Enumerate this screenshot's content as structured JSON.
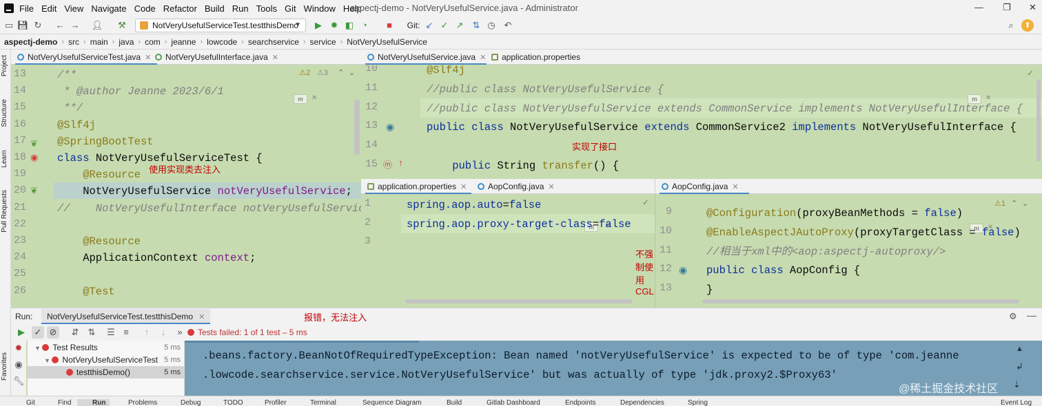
{
  "menubar": {
    "items": [
      "File",
      "Edit",
      "View",
      "Navigate",
      "Code",
      "Refactor",
      "Build",
      "Run",
      "Tools",
      "Git",
      "Window",
      "Help"
    ],
    "title": "aspectj-demo - NotVeryUsefulService.java - Administrator"
  },
  "toolbar": {
    "run_config": "NotVeryUsefulServiceTest.testthisDemo",
    "git_label": "Git:"
  },
  "breadcrumb": [
    "aspectj-demo",
    "src",
    "main",
    "java",
    "com",
    "jeanne",
    "lowcode",
    "searchservice",
    "service",
    "NotVeryUsefulService"
  ],
  "left_strip": [
    "Project",
    "Structure",
    "Learn",
    "Pull Requests",
    "Favorites"
  ],
  "left_editor": {
    "tabs": [
      "NotVeryUsefulServiceTest.java",
      "NotVeryUsefulInterface.java"
    ],
    "inspections": {
      "warnings": "2",
      "weak": "3"
    },
    "lines": [
      {
        "n": "13",
        "parts": [
          {
            "c": "cm",
            "t": "/**"
          }
        ]
      },
      {
        "n": "14",
        "parts": [
          {
            "c": "cm",
            "t": " * @author Jeanne 2023/6/1"
          }
        ]
      },
      {
        "n": "15",
        "parts": [
          {
            "c": "cm",
            "t": " **/"
          }
        ]
      },
      {
        "n": "16",
        "parts": [
          {
            "c": "an",
            "t": "@Slf4j"
          }
        ]
      },
      {
        "n": "17",
        "parts": [
          {
            "c": "an",
            "t": "@SpringBootTest"
          }
        ]
      },
      {
        "n": "18",
        "parts": [
          {
            "c": "kw",
            "t": "class "
          },
          {
            "c": "",
            "t": "NotVeryUsefulServiceTest {"
          }
        ]
      },
      {
        "n": "19",
        "parts": [
          {
            "c": "an",
            "t": "    @Resource"
          }
        ]
      },
      {
        "n": "20",
        "parts": [
          {
            "c": "",
            "t": "    NotVeryUsefulService "
          },
          {
            "c": "fld",
            "t": "notVeryUsefulService"
          },
          {
            "c": "",
            "t": ";"
          }
        ]
      },
      {
        "n": "21",
        "parts": [
          {
            "c": "cm",
            "t": "//    NotVeryUsefulInterface notVeryUsefulService;"
          }
        ]
      },
      {
        "n": "22",
        "parts": [
          {
            "c": "",
            "t": ""
          }
        ]
      },
      {
        "n": "23",
        "parts": [
          {
            "c": "an",
            "t": "    @Resource"
          }
        ]
      },
      {
        "n": "24",
        "parts": [
          {
            "c": "",
            "t": "    ApplicationContext "
          },
          {
            "c": "fld",
            "t": "context"
          },
          {
            "c": "",
            "t": ";"
          }
        ]
      },
      {
        "n": "25",
        "parts": [
          {
            "c": "",
            "t": ""
          }
        ]
      },
      {
        "n": "26",
        "parts": [
          {
            "c": "an",
            "t": "    @Test"
          }
        ]
      }
    ],
    "annotation": "使用实现类去注入"
  },
  "right_top_editor": {
    "tabs": [
      "NotVeryUsefulService.java",
      "application.properties"
    ],
    "lines": [
      {
        "n": "10",
        "parts": [
          {
            "c": "an",
            "t": "@Slf4j"
          }
        ]
      },
      {
        "n": "11",
        "parts": [
          {
            "c": "cm",
            "t": "//public class NotVeryUsefulService {"
          }
        ]
      },
      {
        "n": "12",
        "parts": [
          {
            "c": "cm",
            "t": "//public class NotVeryUsefulService extends CommonService implements NotVeryUsefulInterface {"
          }
        ]
      },
      {
        "n": "13",
        "parts": [
          {
            "c": "kw",
            "t": "public class "
          },
          {
            "c": "",
            "t": "NotVeryUsefulService "
          },
          {
            "c": "kw",
            "t": "extends "
          },
          {
            "c": "",
            "t": "CommonService2 "
          },
          {
            "c": "kw",
            "t": "implements "
          },
          {
            "c": "",
            "t": "NotVeryUsefulInterface {"
          }
        ]
      },
      {
        "n": "14",
        "parts": [
          {
            "c": "",
            "t": ""
          }
        ]
      },
      {
        "n": "15",
        "parts": [
          {
            "c": "kw",
            "t": "    public "
          },
          {
            "c": "",
            "t": "String "
          },
          {
            "c": "an",
            "t": "transfer"
          },
          {
            "c": "",
            "t": "() {"
          }
        ]
      }
    ],
    "annotation": "实现了接口"
  },
  "props_editor": {
    "tabs": [
      "application.properties",
      "AopConfig.java"
    ],
    "lines": [
      {
        "n": "1",
        "parts": [
          {
            "c": "kw",
            "t": "spring.aop.auto"
          },
          {
            "c": "",
            "t": "="
          },
          {
            "c": "kw",
            "t": "false"
          }
        ]
      },
      {
        "n": "2",
        "parts": [
          {
            "c": "kw",
            "t": "spring.aop.proxy-target-class"
          },
          {
            "c": "",
            "t": "="
          },
          {
            "c": "kw",
            "t": "false"
          }
        ]
      },
      {
        "n": "3",
        "parts": [
          {
            "c": "",
            "t": ""
          }
        ]
      }
    ],
    "annotation": "不强制使用CGLIb"
  },
  "aop_editor": {
    "tabs": [
      "AopConfig.java"
    ],
    "inspections": {
      "warnings": "1"
    },
    "lines": [
      {
        "n": "9",
        "parts": [
          {
            "c": "an",
            "t": "@Configuration"
          },
          {
            "c": "",
            "t": "(proxyBeanMethods = "
          },
          {
            "c": "kw",
            "t": "false"
          },
          {
            "c": "",
            "t": ")"
          }
        ]
      },
      {
        "n": "10",
        "parts": [
          {
            "c": "an",
            "t": "@EnableAspectJAutoProxy"
          },
          {
            "c": "",
            "t": "(proxyTargetClass = "
          },
          {
            "c": "kw",
            "t": "false"
          },
          {
            "c": "",
            "t": ")"
          }
        ]
      },
      {
        "n": "11",
        "parts": [
          {
            "c": "cm",
            "t": "//相当于xml中的<aop:aspectj-autoproxy/>"
          }
        ]
      },
      {
        "n": "12",
        "parts": [
          {
            "c": "kw",
            "t": "public class "
          },
          {
            "c": "",
            "t": "AopConfig {"
          }
        ]
      },
      {
        "n": "13",
        "parts": [
          {
            "c": "",
            "t": "}"
          }
        ]
      }
    ]
  },
  "run_panel": {
    "label": "Run:",
    "tab": "NotVeryUsefulServiceTest.testthisDemo",
    "annotation": "报错，无法注入",
    "status": "Tests failed: 1 of 1 test – 5 ms",
    "tree": [
      {
        "label": "Test Results",
        "ms": "5 ms",
        "indent": 0
      },
      {
        "label": "NotVeryUsefulServiceTest",
        "ms": "5 ms",
        "indent": 1
      },
      {
        "label": "testthisDemo()",
        "ms": "5 ms",
        "indent": 2
      }
    ],
    "console": [
      ".beans.factory.BeanNotOfRequiredTypeException: Bean named 'notVeryUsefulService' is expected to be of type 'com.jeanne",
      ".lowcode.searchservice.service.NotVeryUsefulService' but was actually of type 'jdk.proxy2.$Proxy63'"
    ]
  },
  "statusbar": [
    "Git",
    "Find",
    "Run",
    "Problems",
    "Debug",
    "TODO",
    "Profiler",
    "Terminal",
    "Sequence Diagram",
    "Build",
    "Gitlab Dashboard",
    "Endpoints",
    "Dependencies",
    "Spring",
    "Event Log"
  ],
  "watermark": "@稀土掘金技术社区",
  "colors": {
    "editor_bg": "#c7dbb0",
    "console_bg": "#77a0b8",
    "annotation": "#c00000"
  }
}
